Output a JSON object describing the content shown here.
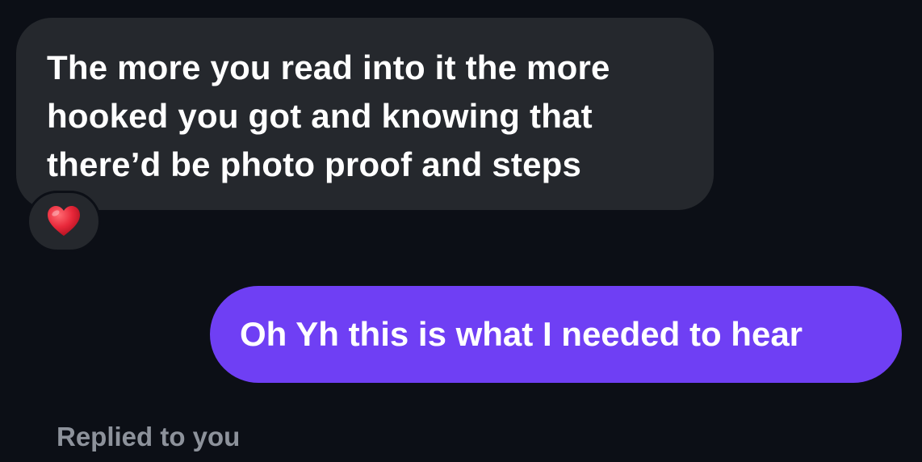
{
  "messages": {
    "incoming": {
      "text": "The more you read into it the more hooked you got and knowing that there’d be photo proof and steps",
      "reaction_icon": "red-heart-icon",
      "bubble_color": "#25282d"
    },
    "outgoing": {
      "text": "Oh Yh this is what I needed to hear",
      "bubble_color": "#6f3ff4"
    }
  },
  "footer": {
    "status": "Replied to you"
  },
  "colors": {
    "background": "#0c0f16",
    "heart": "#e8283a",
    "status_text": "#8d929b"
  }
}
